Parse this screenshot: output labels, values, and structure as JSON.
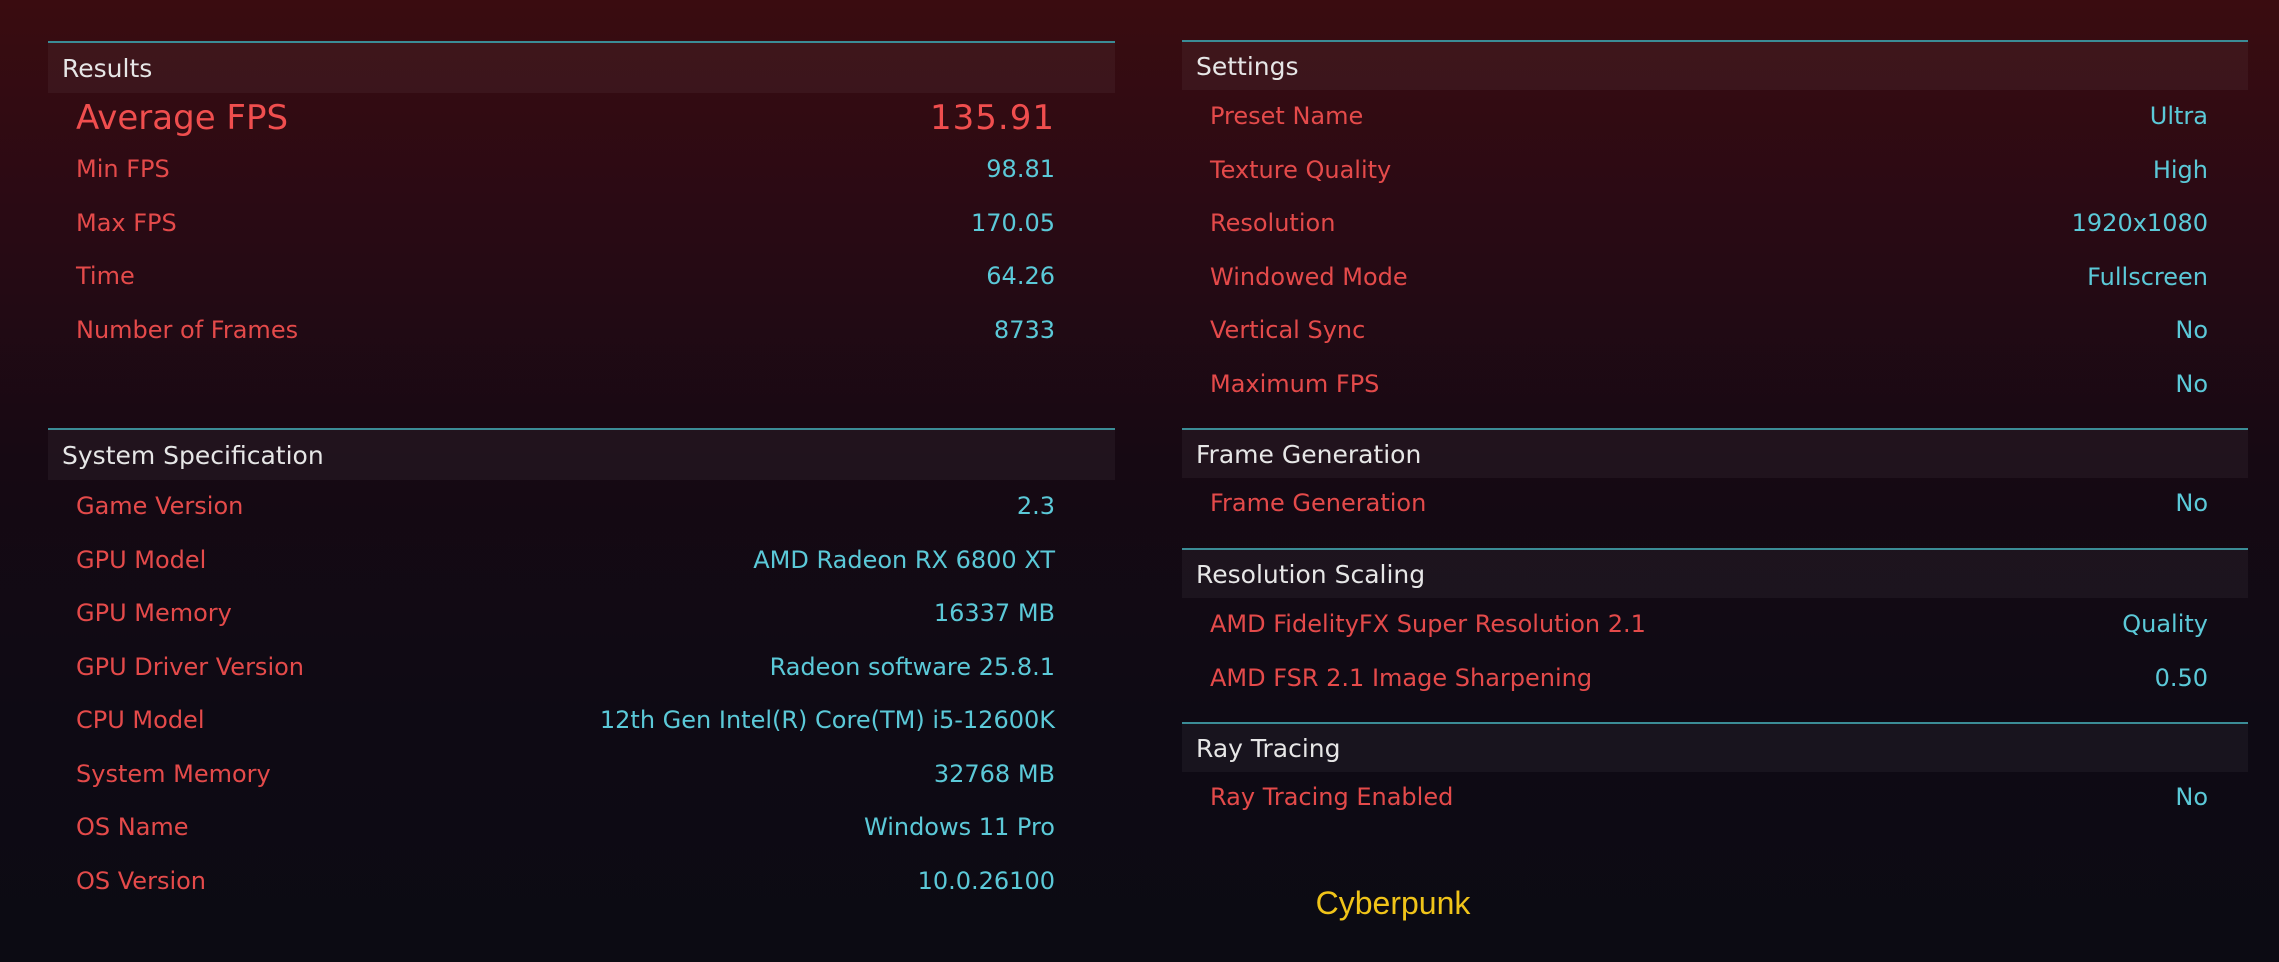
{
  "colors": {
    "label": "#e44a4a",
    "value": "#5bc9d8",
    "header_border": "#3b8c96",
    "caption": "#f0c419"
  },
  "results": {
    "header": "Results",
    "rows": [
      {
        "label": "Average FPS",
        "value": "135.91"
      },
      {
        "label": "Min FPS",
        "value": "98.81"
      },
      {
        "label": "Max FPS",
        "value": "170.05"
      },
      {
        "label": "Time",
        "value": "64.26"
      },
      {
        "label": "Number of Frames",
        "value": "8733"
      }
    ]
  },
  "system": {
    "header": "System Specification",
    "rows": [
      {
        "label": "Game Version",
        "value": "2.3"
      },
      {
        "label": "GPU Model",
        "value": "AMD Radeon RX 6800 XT"
      },
      {
        "label": "GPU Memory",
        "value": "16337 MB"
      },
      {
        "label": "GPU Driver Version",
        "value": "Radeon software 25.8.1"
      },
      {
        "label": "CPU Model",
        "value": "12th Gen Intel(R) Core(TM) i5-12600K"
      },
      {
        "label": "System Memory",
        "value": "32768 MB"
      },
      {
        "label": "OS Name",
        "value": "Windows 11 Pro"
      },
      {
        "label": "OS Version",
        "value": "10.0.26100"
      }
    ]
  },
  "settings": {
    "header": "Settings",
    "rows": [
      {
        "label": "Preset Name",
        "value": "Ultra"
      },
      {
        "label": "Texture Quality",
        "value": "High"
      },
      {
        "label": "Resolution",
        "value": "1920x1080"
      },
      {
        "label": "Windowed Mode",
        "value": "Fullscreen"
      },
      {
        "label": "Vertical Sync",
        "value": "No"
      },
      {
        "label": "Maximum FPS",
        "value": "No"
      }
    ]
  },
  "frame_generation": {
    "header": "Frame Generation",
    "rows": [
      {
        "label": "Frame Generation",
        "value": "No"
      }
    ]
  },
  "resolution_scaling": {
    "header": "Resolution Scaling",
    "rows": [
      {
        "label": "AMD FidelityFX Super Resolution 2.1",
        "value": "Quality"
      },
      {
        "label": "AMD FSR 2.1 Image Sharpening",
        "value": "0.50"
      }
    ]
  },
  "ray_tracing": {
    "header": "Ray Tracing",
    "rows": [
      {
        "label": "Ray Tracing Enabled",
        "value": "No"
      }
    ]
  },
  "caption": "Cyberpunk"
}
